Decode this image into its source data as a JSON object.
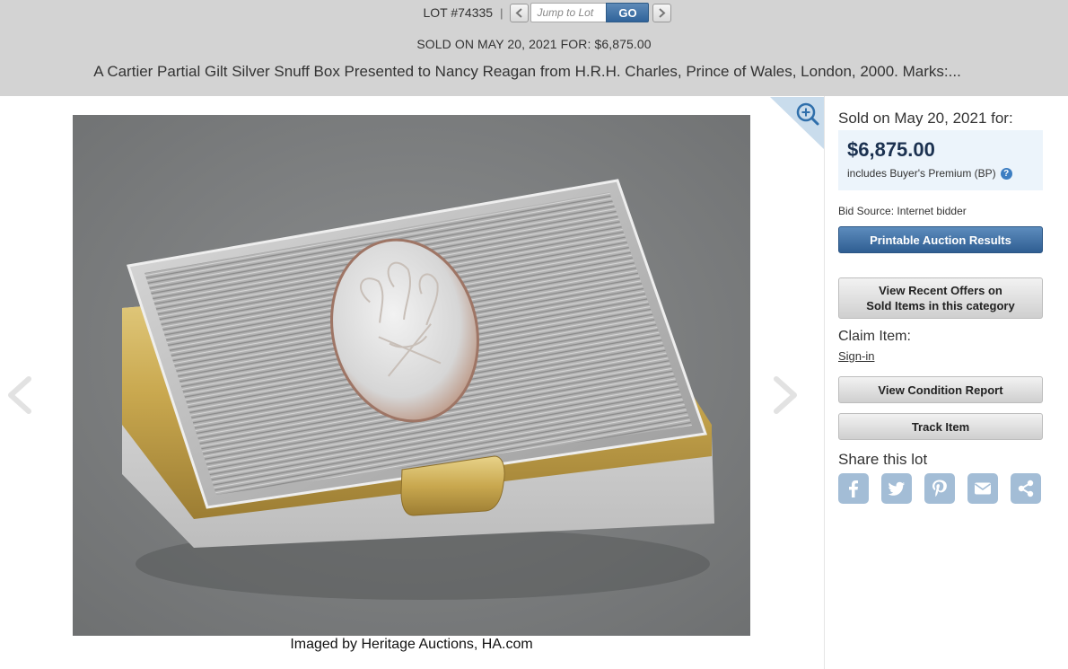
{
  "header": {
    "lot_label": "LOT #74335",
    "separator": "|",
    "jump_placeholder": "Jump to Lot",
    "go_label": "GO",
    "sold_line": "SOLD ON MAY 20, 2021 FOR: $6,875.00",
    "title": "A Cartier Partial Gilt Silver Snuff Box Presented to Nancy Reagan from H.R.H. Charles, Prince of Wales, London, 2000. Marks:..."
  },
  "image": {
    "credit": "Imaged by Heritage Auctions, HA.com"
  },
  "sidebar": {
    "sold_on": "Sold on May 20, 2021 for:",
    "price": "$6,875.00",
    "bp_note": "includes Buyer's Premium (BP)",
    "help_glyph": "?",
    "bid_source": "Bid Source: Internet bidder",
    "printable_results": "Printable Auction Results",
    "recent_offers_line1": "View Recent Offers on",
    "recent_offers_line2": "Sold Items in this category",
    "claim_title": "Claim Item:",
    "sign_in": "Sign-in",
    "condition_report": "View Condition Report",
    "track_item": "Track Item",
    "share_title": "Share this lot"
  },
  "icons": {
    "prev_lot": "chevron-left-icon",
    "next_lot": "chevron-right-icon",
    "zoom": "zoom-in-icon",
    "share": [
      "facebook-icon",
      "twitter-icon",
      "pinterest-icon",
      "email-icon",
      "share-icon"
    ]
  },
  "colors": {
    "header_band": "#d3d3d3",
    "accent_blue": "#30639a",
    "price_text": "#1b3150",
    "price_box": "#ecf4fb",
    "share_icons": "#a3bdd6"
  }
}
